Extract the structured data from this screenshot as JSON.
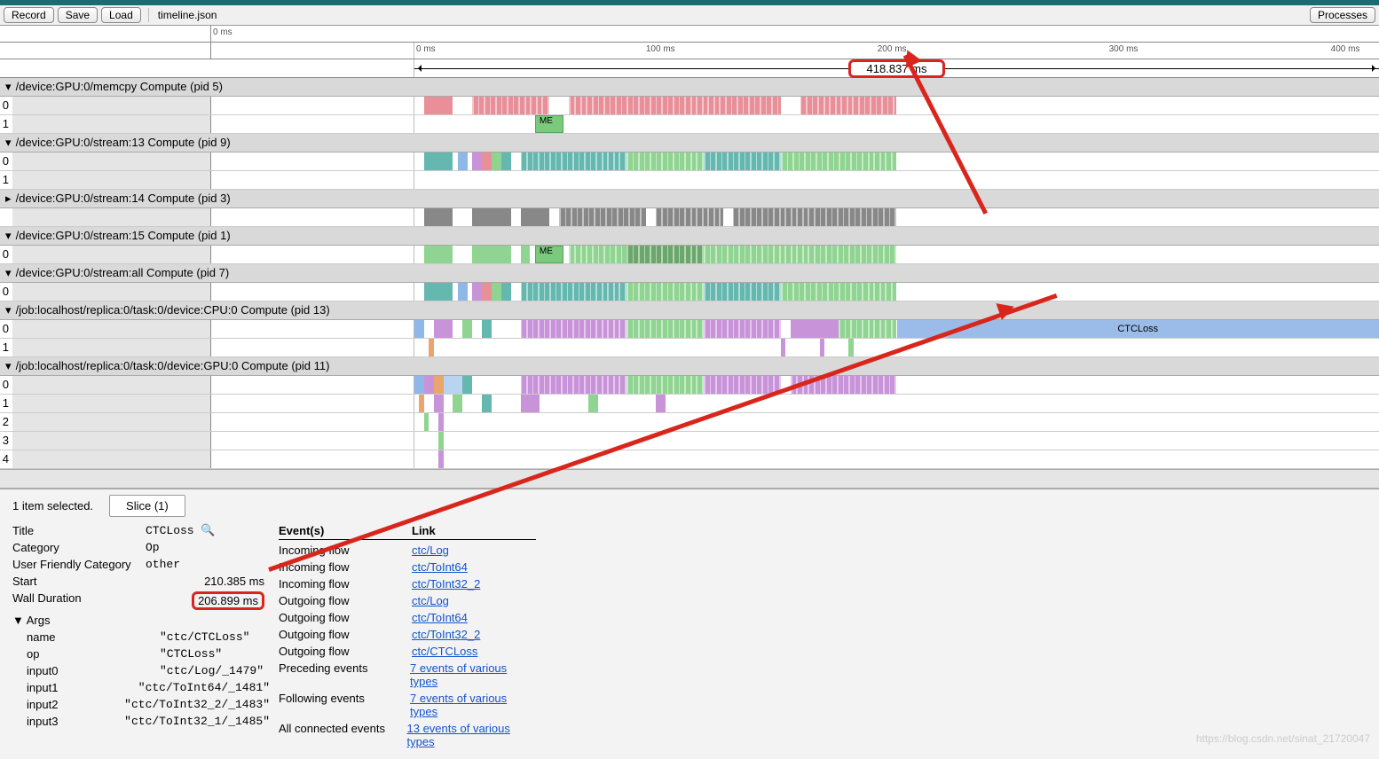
{
  "toolbar": {
    "record": "Record",
    "save": "Save",
    "load": "Load",
    "file": "timeline.json",
    "processes": "Processes"
  },
  "ruler1": {
    "ticks": [
      "0 ms"
    ]
  },
  "ruler2": {
    "ticks": [
      "0 ms",
      "100 ms",
      "200 ms",
      "300 ms",
      "400 ms"
    ]
  },
  "range_label": "418.837 ms",
  "procs": [
    {
      "name": "/device:GPU:0/memcpy Compute (pid 5)",
      "caret": "▾",
      "rows": [
        "0",
        "1"
      ]
    },
    {
      "name": "/device:GPU:0/stream:13 Compute (pid 9)",
      "caret": "▾",
      "rows": [
        "0",
        "1"
      ]
    },
    {
      "name": "/device:GPU:0/stream:14 Compute (pid 3)",
      "caret": "▸",
      "rows": [
        ""
      ]
    },
    {
      "name": "/device:GPU:0/stream:15 Compute (pid 1)",
      "caret": "▾",
      "rows": [
        "0"
      ]
    },
    {
      "name": "/device:GPU:0/stream:all Compute (pid 7)",
      "caret": "▾",
      "rows": [
        "0"
      ]
    },
    {
      "name": "/job:localhost/replica:0/task:0/device:CPU:0 Compute (pid 13)",
      "caret": "▾",
      "rows": [
        "0",
        "1"
      ]
    },
    {
      "name": "/job:localhost/replica:0/task:0/device:GPU:0 Compute (pid 11)",
      "caret": "▾",
      "rows": [
        "0",
        "1",
        "2",
        "3",
        "4"
      ]
    }
  ],
  "me_label": "ME",
  "ctc_label": "CTCLoss",
  "selection": {
    "count": "1 item selected.",
    "tab": "Slice (1)"
  },
  "props": [
    {
      "k": "Title",
      "v": "CTCLoss",
      "search": true
    },
    {
      "k": "Category",
      "v": "Op"
    },
    {
      "k": "User Friendly Category",
      "v": "other"
    },
    {
      "k": "Start",
      "v": "210.385 ms",
      "right": true
    },
    {
      "k": "Wall Duration",
      "v": "206.899 ms",
      "right": true,
      "hl": true
    }
  ],
  "args_hdr": "Args",
  "args": [
    {
      "k": "name",
      "v": "\"ctc/CTCLoss\""
    },
    {
      "k": "op",
      "v": "\"CTCLoss\""
    },
    {
      "k": "input0",
      "v": "\"ctc/Log/_1479\""
    },
    {
      "k": "input1",
      "v": "\"ctc/ToInt64/_1481\""
    },
    {
      "k": "input2",
      "v": "\"ctc/ToInt32_2/_1483\""
    },
    {
      "k": "input3",
      "v": "\"ctc/ToInt32_1/_1485\""
    }
  ],
  "events_hdr": {
    "e": "Event(s)",
    "l": "Link"
  },
  "events": [
    {
      "e": "Incoming flow",
      "l": "ctc/Log"
    },
    {
      "e": "Incoming flow",
      "l": "ctc/ToInt64"
    },
    {
      "e": "Incoming flow",
      "l": "ctc/ToInt32_2"
    },
    {
      "e": "Outgoing flow",
      "l": "ctc/Log"
    },
    {
      "e": "Outgoing flow",
      "l": "ctc/ToInt64"
    },
    {
      "e": "Outgoing flow",
      "l": "ctc/ToInt32_2"
    },
    {
      "e": "Outgoing flow",
      "l": "ctc/CTCLoss"
    },
    {
      "e": "Preceding events",
      "l": "7 events of various types"
    },
    {
      "e": "Following events",
      "l": "7 events of various types"
    },
    {
      "e": "All connected events",
      "l": "13 events of various types"
    }
  ],
  "watermark": "https://blog.csdn.net/sinat_21720047"
}
